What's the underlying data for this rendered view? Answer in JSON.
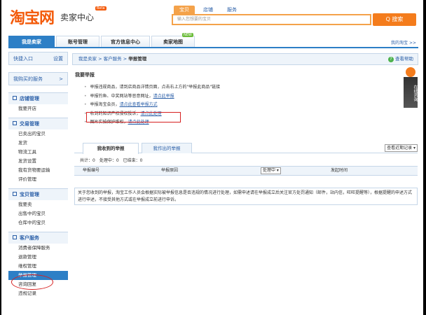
{
  "header": {
    "logo": "淘宝网",
    "logo_sub": "卖家中心",
    "beta": "Beta",
    "search_tabs": [
      "宝贝",
      "店铺",
      "服务"
    ],
    "search_placeholder": "输入您想要的宝贝",
    "search_button": "Q 搜索"
  },
  "nav": {
    "tabs": [
      "我是卖家",
      "账号管理",
      "官方信息中心",
      "卖家地图"
    ],
    "new_badge": "NEW",
    "my_taobao": "我的淘宝 >>"
  },
  "sidebar": {
    "quick_entry": "快捷入口",
    "settings": "设置",
    "my_services": "我购买的服务",
    "arrow": ">",
    "sections": [
      {
        "title": "店铺管理",
        "items": [
          "我要开店"
        ]
      },
      {
        "title": "交易管理",
        "items": [
          "已卖出的宝贝",
          "发货",
          "物流工具",
          "发货设置",
          "我有货物要运输",
          "评价管理"
        ]
      },
      {
        "title": "宝贝管理",
        "items": [
          "我要卖",
          "出售中的宝贝",
          "仓库中的宝贝"
        ]
      },
      {
        "title": "客户服务",
        "items": [
          "消费者保障服务",
          "退款管理",
          "维权管理",
          "举报管理",
          "咨询回复",
          "违规记录"
        ]
      }
    ]
  },
  "main": {
    "breadcrumb": [
      "我是卖家",
      "客户服务"
    ],
    "breadcrumb_sep": ">",
    "breadcrumb_current": "举报管理",
    "help": "查看帮助",
    "help_icon": "?",
    "panel_title": "我要举报",
    "bullets": [
      {
        "text": "举报违规商品，请到店商品详情页面，点击右上方的\"举报此商品\"链接",
        "link": ""
      },
      {
        "text": "举报钓鱼、中奖网站等恶意网址，",
        "link": "请点此举报"
      },
      {
        "text": "举报淘宝会员，",
        "link": "请点此查看举报方式"
      },
      {
        "text": "收到的知识产权侵权投诉，",
        "link": "请点此处理"
      },
      {
        "text": "图片实拍保护维权，",
        "link": "请点此处理"
      }
    ],
    "cs_label": "在线咨询",
    "tabs": [
      "我收到的举报",
      "我作出的举报"
    ],
    "recent": "查看近期记录 ▾",
    "counts": "共计：0　处理中：0　已结束：0",
    "columns": [
      "举报编号",
      "举报原因",
      "处理中 ▾",
      "发起时间"
    ],
    "notice": "关于您收到的举报，淘宝工作人员会根据实际被举报信息是否违规的情况进行处理，如需申述请在举报成立后关注官方处罚通知（邮件，站内信，旺旺提醒等），根据提醒的申述方式进行申述，不接受其他方式或在举报成立前进行申诉。"
  }
}
